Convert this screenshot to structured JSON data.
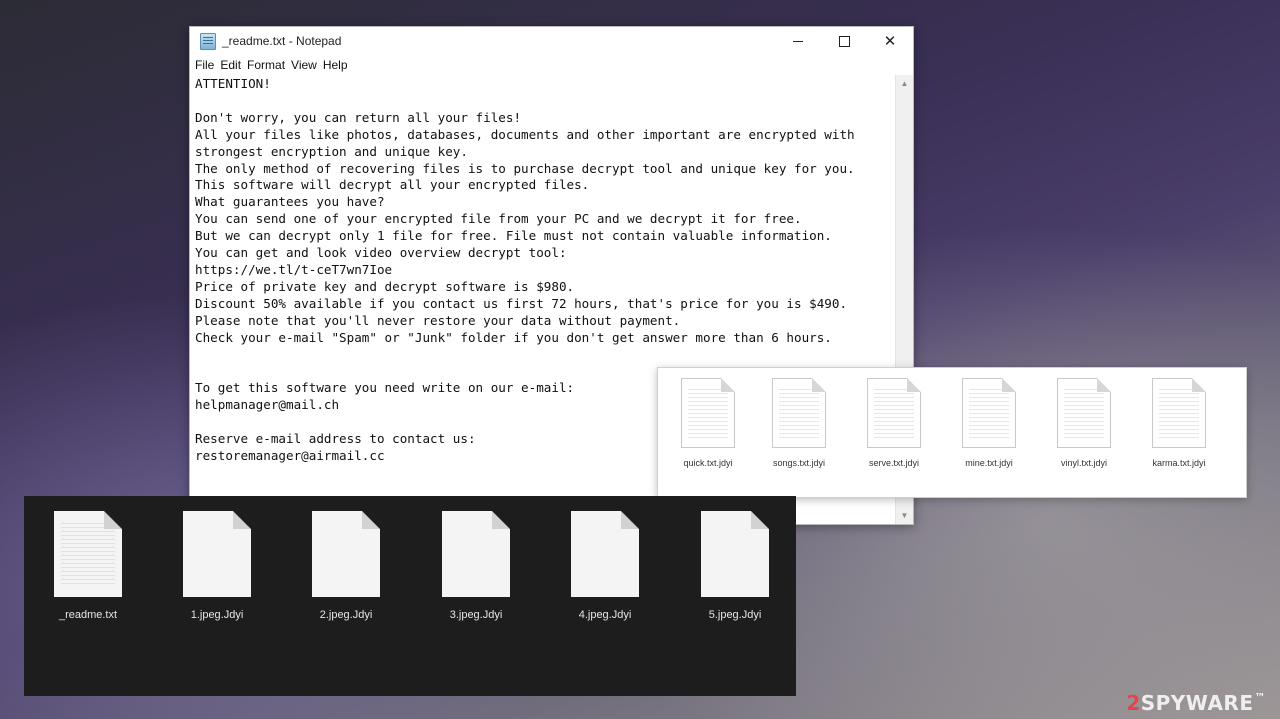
{
  "notepad": {
    "title": "_readme.txt - Notepad",
    "menu": [
      "File",
      "Edit",
      "Format",
      "View",
      "Help"
    ],
    "controls": {
      "minimize": "minimize",
      "maximize": "maximize",
      "close": "✕"
    },
    "text": "ATTENTION!\n\nDon't worry, you can return all your files!\nAll your files like photos, databases, documents and other important are encrypted with\nstrongest encryption and unique key.\nThe only method of recovering files is to purchase decrypt tool and unique key for you.\nThis software will decrypt all your encrypted files.\nWhat guarantees you have?\nYou can send one of your encrypted file from your PC and we decrypt it for free.\nBut we can decrypt only 1 file for free. File must not contain valuable information.\nYou can get and look video overview decrypt tool:\nhttps://we.tl/t-ceT7wn7Ioe\nPrice of private key and decrypt software is $980.\nDiscount 50% available if you contact us first 72 hours, that's price for you is $490.\nPlease note that you'll never restore your data without payment.\nCheck your e-mail \"Spam\" or \"Junk\" folder if you don't get answer more than 6 hours.\n\n\nTo get this software you need write on our e-mail:\nhelpmanager@mail.ch\n\nReserve e-mail address to contact us:\nrestoremanager@airmail.cc"
  },
  "white_panel_files": [
    "quick.txt.jdyi",
    "songs.txt.jdyi",
    "serve.txt.jdyi",
    "mine.txt.jdyi",
    "vinyl.txt.jdyi",
    "karma.txt.jdyi"
  ],
  "dark_panel_files": [
    "_readme.txt",
    "1.jpeg.Jdyi",
    "2.jpeg.Jdyi",
    "3.jpeg.Jdyi",
    "4.jpeg.Jdyi",
    "5.jpeg.Jdyi"
  ],
  "watermark": {
    "prefix": "2",
    "name": "SPYWAR",
    "suffix": "E"
  }
}
